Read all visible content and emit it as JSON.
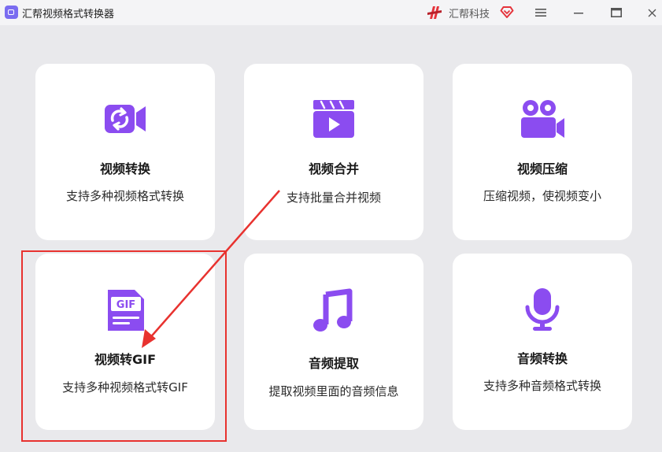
{
  "app": {
    "title": "汇帮视频格式转换器",
    "brand": "汇帮科技"
  },
  "colors": {
    "accent": "#8b4cf0",
    "annotation": "#e8322f",
    "brand_red": "#e5333b"
  },
  "cards": [
    {
      "title": "视频转换",
      "desc": "支持多种视频格式转换",
      "icon": "video-convert-icon"
    },
    {
      "title": "视频合并",
      "desc": "支持批量合并视频",
      "icon": "clapperboard-play-icon"
    },
    {
      "title": "视频压缩",
      "desc": "压缩视频，使视频变小",
      "icon": "movie-camera-icon"
    },
    {
      "title": "视频转GIF",
      "desc": "支持多种视频格式转GIF",
      "icon": "gif-file-icon"
    },
    {
      "title": "音频提取",
      "desc": "提取视频里面的音频信息",
      "icon": "music-note-icon"
    },
    {
      "title": "音频转换",
      "desc": "支持多种音频格式转换",
      "icon": "microphone-icon"
    }
  ]
}
